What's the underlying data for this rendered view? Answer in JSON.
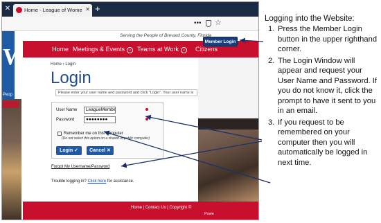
{
  "browser": {
    "close_glyph": "✕",
    "tab_title": "Home - League of Women Vot",
    "tab_close": "✕",
    "new_tab": "+",
    "menu_dots": "•••",
    "star": "☆"
  },
  "site": {
    "logo_letter": "W",
    "left_fragment": "Peop",
    "tagline": "Serving the People of Brevard County, Florida",
    "member_login": "Member Login",
    "nav": [
      {
        "label": "Home",
        "has_menu": false
      },
      {
        "label": "Meetings & Events",
        "has_menu": true
      },
      {
        "label": "Teams at Work",
        "has_menu": true
      },
      {
        "label": "Citizens",
        "has_menu": false
      }
    ],
    "nav_menu_glyph": "⌄",
    "breadcrumb": "Home  ›  Login",
    "login_title": "Login",
    "instructions_text": "Please enter your user name and password and click \"Login\". Your user name is",
    "form": {
      "username_label": "User Name",
      "username_value": "LeagueMember",
      "password_label": "Password",
      "password_value": "●●●●●●●●",
      "remember_label": "Remember me on this computer",
      "remember_note": "(Do not select this option on a shared or public computer)",
      "login_button": "Login ✓",
      "cancel_button": "Cancel ✕"
    },
    "forgot_link": "Forgot My Username/Password",
    "trouble_prefix": "Trouble logging in? ",
    "trouble_link": "Click here",
    "trouble_suffix": " for assistance.",
    "footer_links": "Home  |  Contact Us  |  Copyright ©",
    "footer_sub": "Powe"
  },
  "guide": {
    "heading": "Logging into the Website:",
    "steps": [
      {
        "num": "1.",
        "text": "Press the Member Login button in  the upper righthand corner."
      },
      {
        "num": "2.",
        "text": "The Login Window will appear and request your User Name and Password.  If you do not know it, click the prompt to have it sent to you in an email."
      },
      {
        "num": "3.",
        "text": "If you request to be remembered on your computer then you will automatically be logged in next time."
      }
    ]
  },
  "colors": {
    "nav_red": "#c8102e",
    "brand_blue": "#1f5aa6",
    "arrow_navy": "#1b2f6b"
  }
}
